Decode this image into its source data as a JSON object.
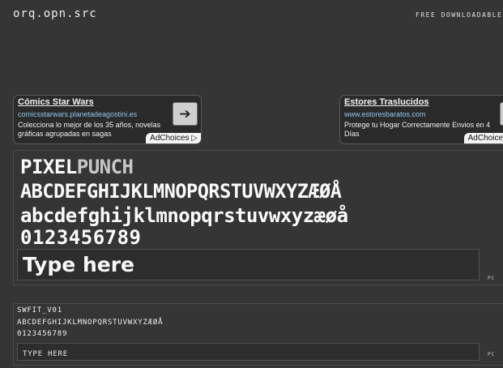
{
  "header": {
    "logo": "orq.opn.src",
    "tagline": "FREE DOWNLOADABLE F"
  },
  "ads": [
    {
      "title": "Cómics Star Wars",
      "url": "comicsstarwars.planetadeagostini.es",
      "description": "Colecciona lo mejor de los 35 años, novelas gráficas agrupadas en sagas",
      "adchoices": "AdChoices",
      "arrow_icon": "arrow-right-icon"
    },
    {
      "title": "Estores Traslucidos",
      "url": "www.estoresbaratos.com",
      "description": "Protege tu Hogar Correctamente Envios en 4 Días",
      "adchoices": "AdChoices",
      "arrow_icon": "arrow-right-icon"
    }
  ],
  "fonts": [
    {
      "name_part1": "PIXEL",
      "name_part2": "PUNCH",
      "uppercase": "ABCDEFGHIJKLMNOPQRSTUVWXYZÆØÅ",
      "lowercase": "abcdefghijklmnopqrstuvwxyzæøå",
      "digits": "0123456789",
      "input_placeholder": "Type here",
      "os": "PC"
    },
    {
      "name": "SWFIT_V01",
      "uppercase": "ABCDEFGHIJKLMNOPQRSTUVWXYZÆØÅ",
      "digits": "0123456789",
      "input_placeholder": "TYPE HERE",
      "os": "PC"
    }
  ],
  "colors": {
    "background": "#353535",
    "ad_background": "#2a2a2a",
    "ad_link": "#8ec6f0",
    "text": "#e8e8e8"
  }
}
